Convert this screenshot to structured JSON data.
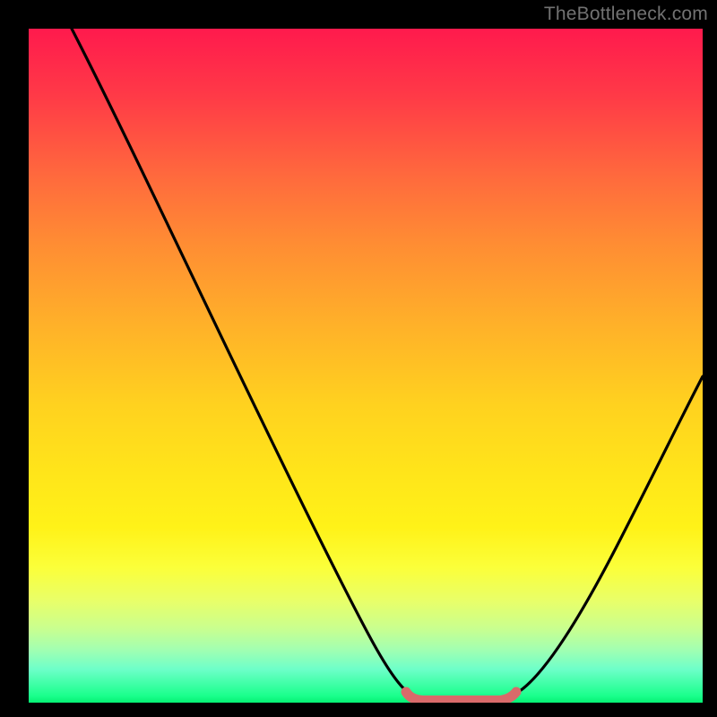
{
  "watermark": "TheBottleneck.com",
  "colors": {
    "frame": "#000000",
    "gradient_top": "#ff1a4d",
    "gradient_bottom": "#05f073",
    "curve": "#000000",
    "plateau": "#d96a6a"
  },
  "chart_data": {
    "type": "line",
    "title": "",
    "xlabel": "",
    "ylabel": "",
    "xlim": [
      0,
      100
    ],
    "ylim": [
      0,
      100
    ],
    "x": [
      0,
      5,
      10,
      15,
      20,
      25,
      30,
      35,
      40,
      45,
      50,
      54,
      56,
      58,
      60,
      64,
      68,
      72,
      75,
      80,
      85,
      90,
      95,
      100
    ],
    "values": [
      100,
      93,
      85,
      77,
      68,
      60,
      52,
      44,
      35,
      27,
      18,
      8,
      4,
      1,
      0,
      0,
      0,
      1,
      3,
      9,
      17,
      26,
      35,
      45
    ],
    "plateau_x_range": [
      56,
      74
    ],
    "plateau_y": 0,
    "annotations": []
  }
}
